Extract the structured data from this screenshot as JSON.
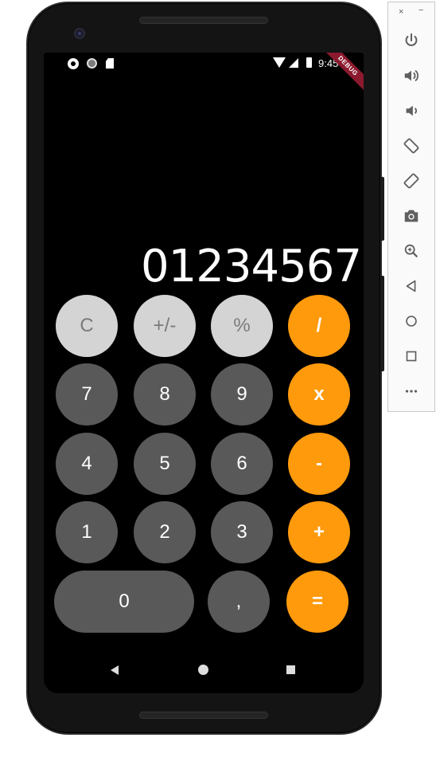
{
  "status_bar": {
    "time": "9:45"
  },
  "debug_banner": "DEBUG",
  "display": {
    "value": "01234567"
  },
  "keys": {
    "clear": "C",
    "sign": "+/-",
    "percent": "%",
    "divide": "/",
    "seven": "7",
    "eight": "8",
    "nine": "9",
    "multiply": "x",
    "four": "4",
    "five": "5",
    "six": "6",
    "minus": "-",
    "one": "1",
    "two": "2",
    "three": "3",
    "plus": "+",
    "zero": "0",
    "decimal": ",",
    "equals": "="
  },
  "colors": {
    "light_key": "#d4d4d4",
    "dark_key": "#595959",
    "operator_key": "#ff9a0d",
    "screen": "#000000"
  },
  "toolbar": {
    "close_label": "×",
    "minimize_label": "−",
    "icons": [
      "power-icon",
      "volume-up-icon",
      "volume-down-icon",
      "rotate-left-icon",
      "rotate-right-icon",
      "camera-icon",
      "zoom-icon",
      "back-icon",
      "home-icon",
      "overview-icon",
      "more-icon"
    ]
  }
}
